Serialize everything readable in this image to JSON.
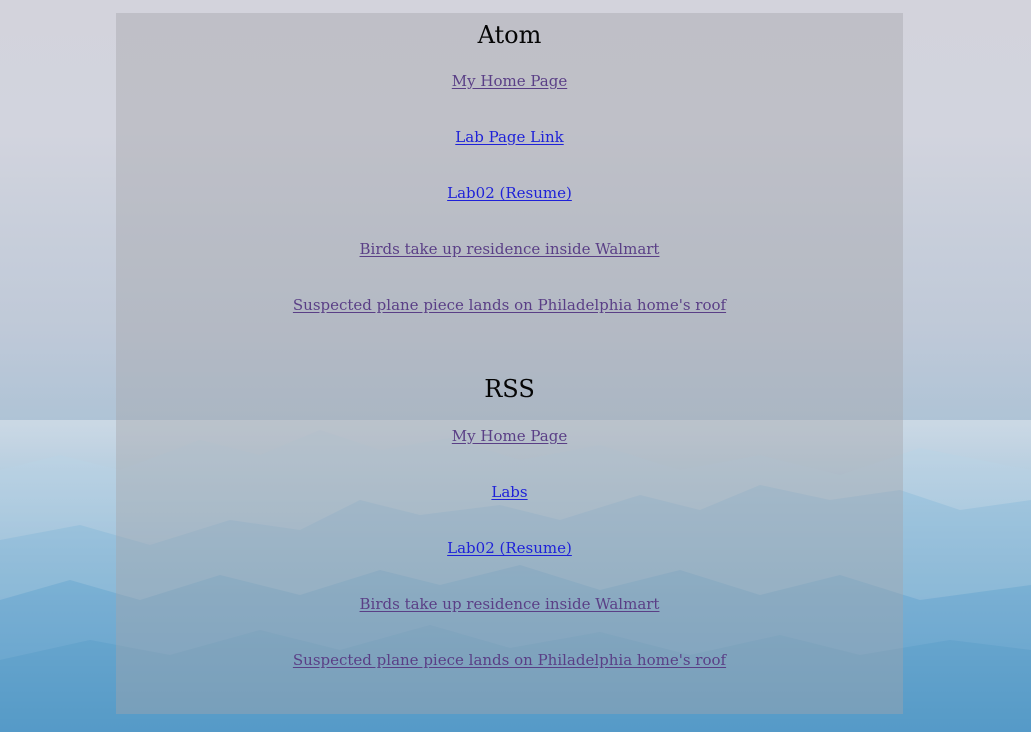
{
  "atom": {
    "title": "Atom",
    "links": [
      {
        "label": "My Home Page",
        "visited": true
      },
      {
        "label": "Lab Page Link",
        "visited": false
      },
      {
        "label": "Lab02 (Resume)",
        "visited": false
      },
      {
        "label": "Birds take up residence inside Walmart",
        "visited": true
      },
      {
        "label": "Suspected plane piece lands on Philadelphia home's roof",
        "visited": true
      }
    ]
  },
  "rss": {
    "title": "RSS",
    "links": [
      {
        "label": "My Home Page",
        "visited": true
      },
      {
        "label": "Labs",
        "visited": false
      },
      {
        "label": "Lab02 (Resume)",
        "visited": false
      },
      {
        "label": "Birds take up residence inside Walmart",
        "visited": true
      },
      {
        "label": "Suspected plane piece lands on Philadelphia home's roof",
        "visited": true
      }
    ]
  },
  "colors": {
    "visited_link": "#5a3f86",
    "unvisited_link": "#1f22d8",
    "panel": "#a5a5aa",
    "sky_top": "#d3d3dc",
    "mountain": "#5c9ec8"
  }
}
